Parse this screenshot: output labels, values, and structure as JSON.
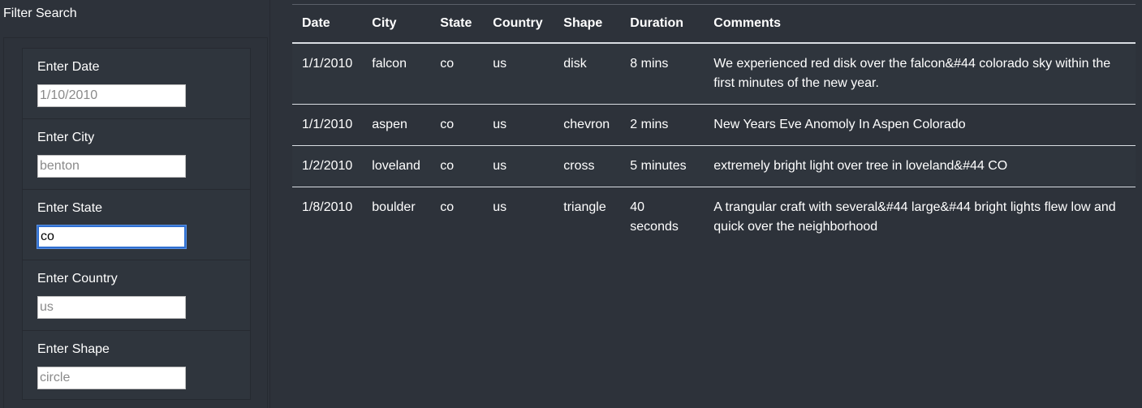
{
  "filter": {
    "title": "Filter Search",
    "fields": [
      {
        "label": "Enter Date",
        "value": "",
        "placeholder": "1/10/2010"
      },
      {
        "label": "Enter City",
        "value": "",
        "placeholder": "benton"
      },
      {
        "label": "Enter State",
        "value": "co",
        "placeholder": ""
      },
      {
        "label": "Enter Country",
        "value": "",
        "placeholder": "us"
      },
      {
        "label": "Enter Shape",
        "value": "",
        "placeholder": "circle"
      }
    ]
  },
  "table": {
    "headers": [
      "Date",
      "City",
      "State",
      "Country",
      "Shape",
      "Duration",
      "Comments"
    ],
    "rows": [
      [
        "1/1/2010",
        "falcon",
        "co",
        "us",
        "disk",
        "8 mins",
        "We experienced red disk over the falcon&#44 colorado sky within the first minutes of the new year."
      ],
      [
        "1/1/2010",
        "aspen",
        "co",
        "us",
        "chevron",
        "2 mins",
        "New Years Eve Anomoly In Aspen Colorado"
      ],
      [
        "1/2/2010",
        "loveland",
        "co",
        "us",
        "cross",
        "5 minutes",
        "extremely bright light over tree in loveland&#44 CO"
      ],
      [
        "1/8/2010",
        "boulder",
        "co",
        "us",
        "triangle",
        "40 seconds",
        "A trangular craft with several&#44 large&#44 bright lights flew low and quick over the neighborhood"
      ]
    ]
  },
  "colors": {
    "background": "#2d323a",
    "stripe": "#2f353d",
    "focus": "#2f6fd0"
  }
}
